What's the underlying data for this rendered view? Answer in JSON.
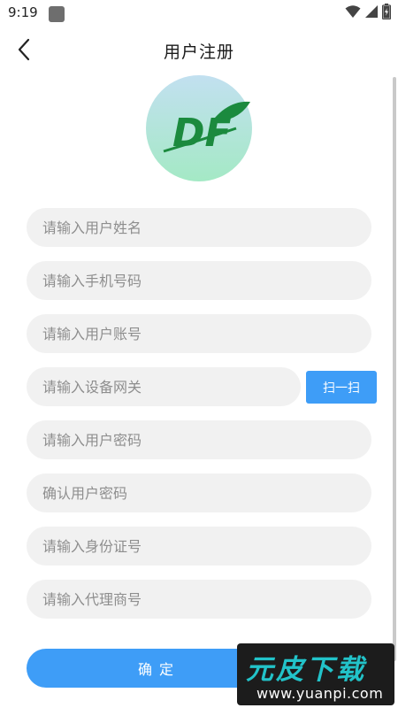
{
  "status_bar": {
    "time": "9:19",
    "icons": [
      "wifi-icon",
      "signal-icon",
      "battery-icon"
    ]
  },
  "header": {
    "title": "用户注册",
    "back_icon": "chevron-left-icon"
  },
  "logo": {
    "text": "DF",
    "icon": "leaf-icon",
    "colors": {
      "gradient_top": "#bfe0ef",
      "gradient_bottom": "#a6e8c7",
      "mark": "#1b8a3e"
    }
  },
  "form": {
    "fields": [
      {
        "placeholder": "请输入用户姓名",
        "value": ""
      },
      {
        "placeholder": "请输入手机号码",
        "value": ""
      },
      {
        "placeholder": "请输入用户账号",
        "value": ""
      },
      {
        "placeholder": "请输入设备网关",
        "value": ""
      },
      {
        "placeholder": "请输入用户密码",
        "value": ""
      },
      {
        "placeholder": "确认用户密码",
        "value": ""
      },
      {
        "placeholder": "请输入身份证号",
        "value": ""
      },
      {
        "placeholder": "请输入代理商号",
        "value": ""
      }
    ],
    "scan_label": "扫一扫",
    "confirm_label": "确定"
  },
  "watermark": {
    "title": "元皮下载",
    "url": "www.yuanpi.com"
  },
  "colors": {
    "accent": "#3e9df7",
    "field_background": "#f1f1f1",
    "placeholder": "#8e8e8e"
  }
}
